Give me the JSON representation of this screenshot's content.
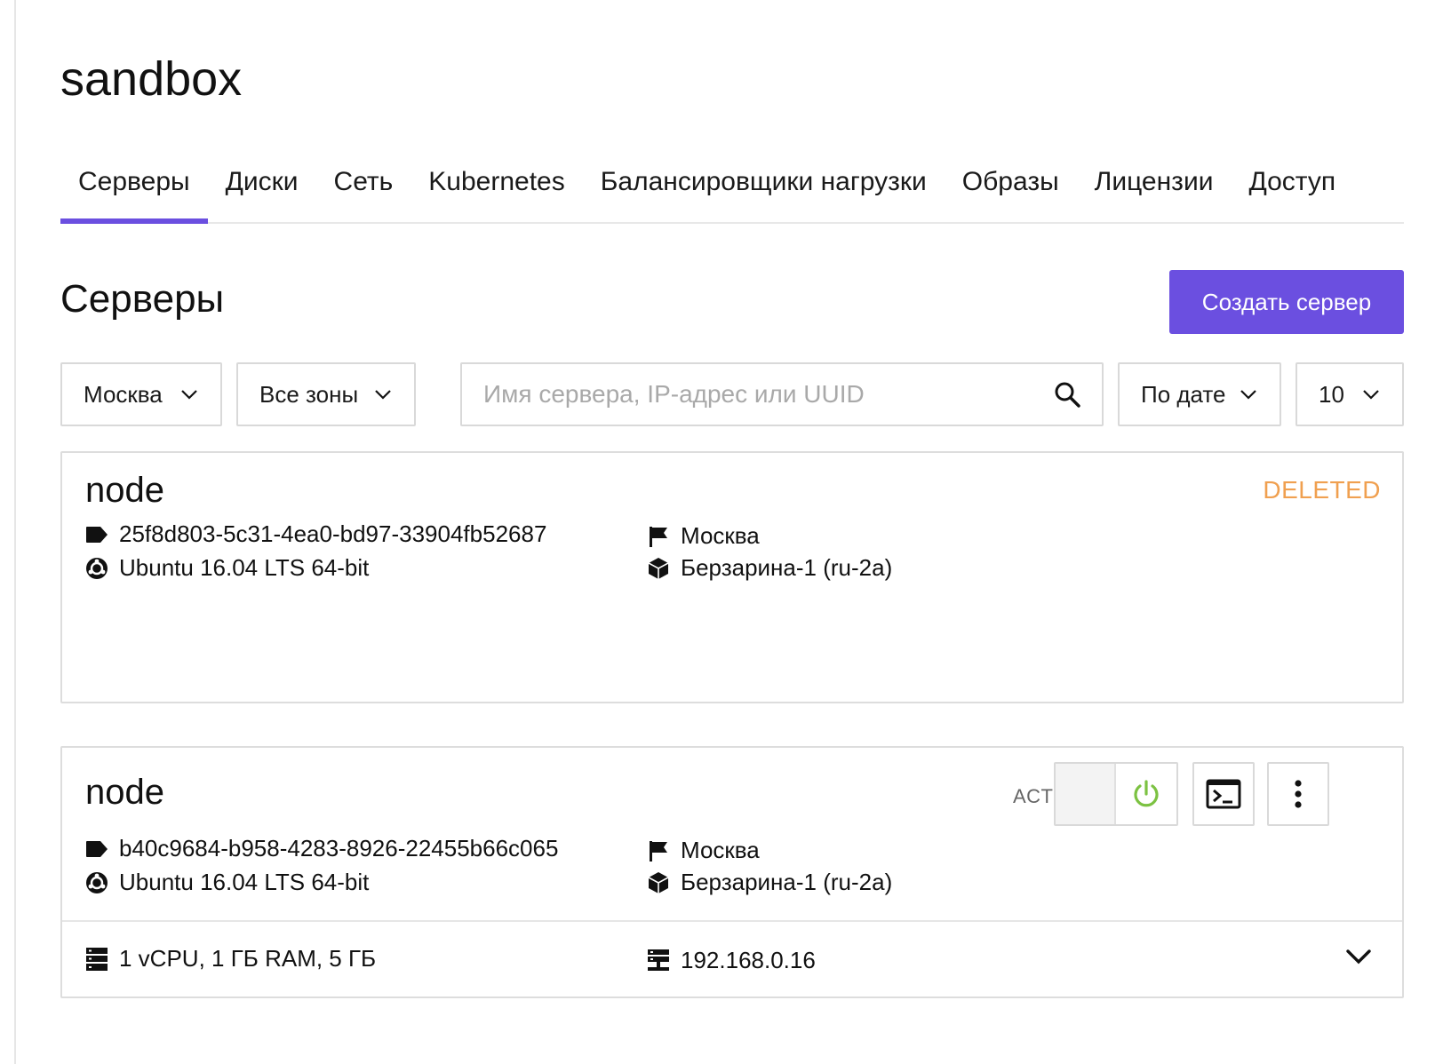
{
  "project": {
    "title": "sandbox"
  },
  "tabs": [
    {
      "label": "Серверы",
      "active": true
    },
    {
      "label": "Диски"
    },
    {
      "label": "Сеть"
    },
    {
      "label": "Kubernetes"
    },
    {
      "label": "Балансировщики нагрузки"
    },
    {
      "label": "Образы"
    },
    {
      "label": "Лицензии"
    },
    {
      "label": "Доступ"
    }
  ],
  "section": {
    "title": "Серверы",
    "create_button": "Создать сервер"
  },
  "filters": {
    "region": "Москва",
    "zone": "Все зоны",
    "search_placeholder": "Имя сервера, IP-адрес или UUID",
    "sort": "По дате",
    "per_page": "10"
  },
  "servers": [
    {
      "name": "node",
      "status": "DELETED",
      "uuid": "25f8d803-5c31-4ea0-bd97-33904fb52687",
      "os": "Ubuntu 16.04 LTS 64-bit",
      "region": "Москва",
      "zone": "Берзарина-1 (ru-2a)"
    },
    {
      "name": "node",
      "status": "ACTIVE",
      "uuid": "b40c9684-b958-4283-8926-22455b66c065",
      "os": "Ubuntu 16.04 LTS 64-bit",
      "region": "Москва",
      "zone": "Берзарина-1 (ru-2a)",
      "specs": "1 vCPU, 1 ГБ RAM, 5 ГБ",
      "ip": "192.168.0.16"
    }
  ],
  "colors": {
    "accent": "#6b4fe0",
    "deleted": "#f0a050",
    "power_on": "#7cc242"
  },
  "icons": {
    "tag": "tag-icon",
    "os": "ubuntu-icon",
    "region": "flag-icon",
    "zone": "cube-icon",
    "specs": "server-stack-icon",
    "ip": "network-icon",
    "power": "power-icon",
    "console": "terminal-icon",
    "more": "more-vertical-icon",
    "expand": "chevron-down-icon",
    "search": "search-icon"
  }
}
